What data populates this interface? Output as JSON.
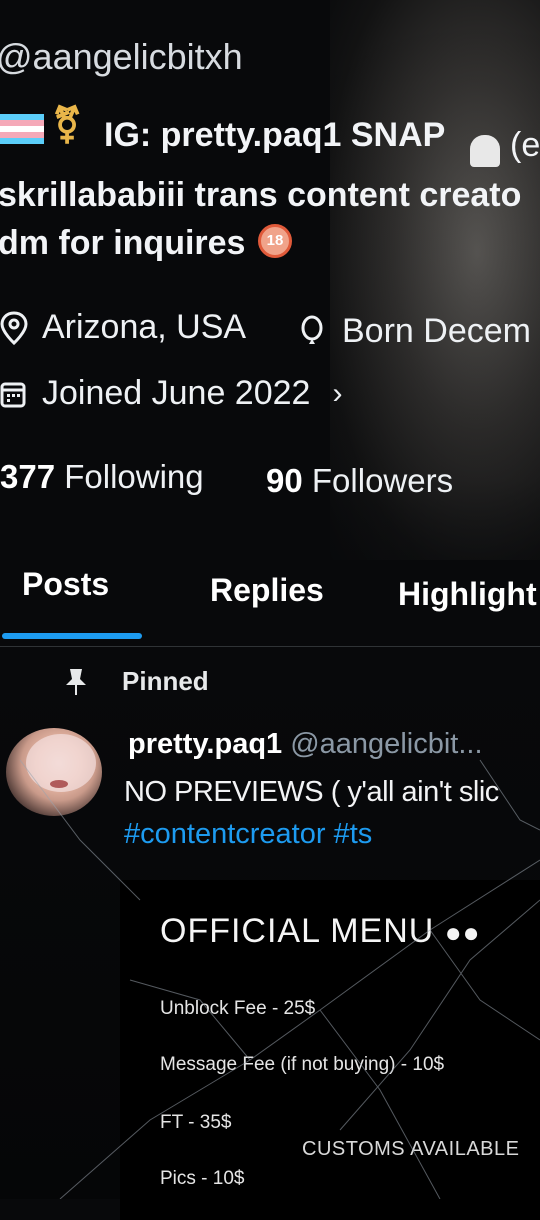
{
  "profile": {
    "handle": "@aangelicbitxh",
    "bio_line1": "IG: pretty.paq1 SNAP",
    "bio_line1_tail": "(e",
    "bio_line2": "skrillababiii trans content creato",
    "bio_line3": "dm for inquires",
    "badge18": "18",
    "location": "Arizona, USA",
    "born": "Born Decem",
    "joined": "Joined June 2022",
    "following_count": "377",
    "following_label": "Following",
    "followers_count": "90",
    "followers_label": "Followers"
  },
  "tabs": [
    {
      "label": "Posts",
      "active": true
    },
    {
      "label": "Replies",
      "active": false
    },
    {
      "label": "Highlight",
      "active": false
    }
  ],
  "pinned_label": "Pinned",
  "tweet": {
    "name": "pretty.paq1",
    "handle": "@aangelicbit...",
    "text": "NO PREVIEWS ( y'all ain't slic",
    "hashtags": "#contentcreator #ts",
    "menu_title": "OFFICIAL MENU",
    "menu_items": [
      "Unblock Fee - 25$",
      "Message Fee (if not buying) - 10$",
      "FT - 35$",
      "Pics - 10$"
    ],
    "customs": "CUSTOMS AVAILABLE"
  },
  "colors": {
    "background": "#08090b",
    "accent": "#1d9bf0",
    "text": "#e9edf2",
    "muted": "#8b98a5"
  }
}
